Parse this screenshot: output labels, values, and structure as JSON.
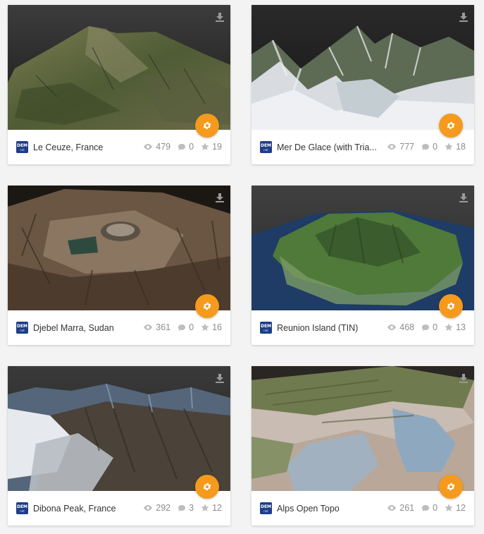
{
  "avatar": {
    "line1": "DEM",
    "line2": "net"
  },
  "colors": {
    "accent": "#f59a1c",
    "avatar": "#1d3e86",
    "stat": "#8c8c8c"
  },
  "icons": {
    "download": "download-icon",
    "settings": "gear-icon",
    "views": "eye-icon",
    "comments": "comment-icon",
    "likes": "star-icon"
  },
  "models": [
    {
      "title": "Le Ceuze, France",
      "views": "479",
      "comments": "0",
      "likes": "19"
    },
    {
      "title": "Mer De Glace (with Tria...",
      "views": "777",
      "comments": "0",
      "likes": "18"
    },
    {
      "title": "Djebel Marra, Sudan",
      "views": "361",
      "comments": "0",
      "likes": "16"
    },
    {
      "title": "Reunion Island (TIN)",
      "views": "468",
      "comments": "0",
      "likes": "13"
    },
    {
      "title": "Dibona Peak, France",
      "views": "292",
      "comments": "3",
      "likes": "12"
    },
    {
      "title": "Alps Open Topo",
      "views": "261",
      "comments": "0",
      "likes": "12"
    }
  ]
}
